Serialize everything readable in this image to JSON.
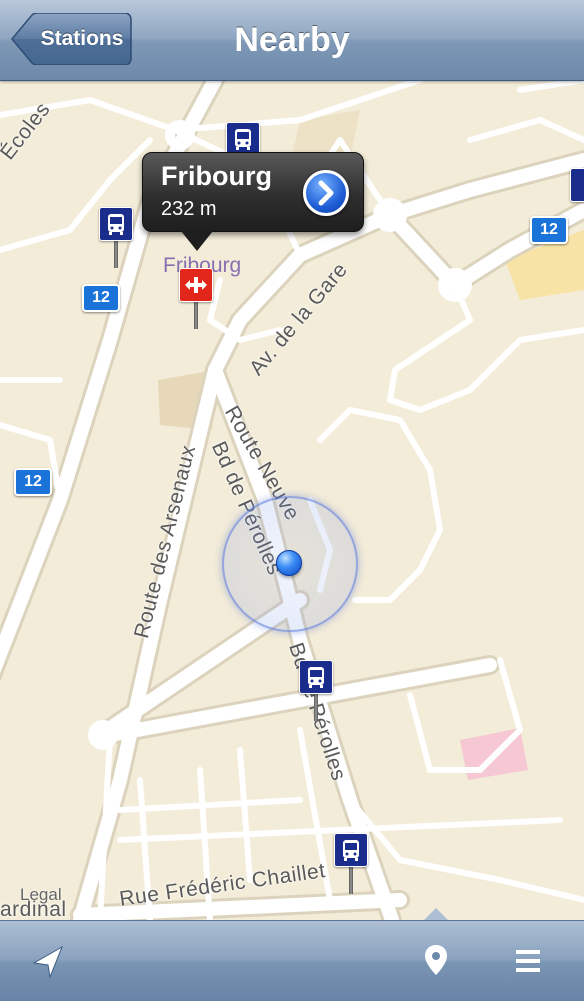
{
  "navbar": {
    "back_label": "Stations",
    "title": "Nearby"
  },
  "callout": {
    "title": "Fribourg",
    "distance": "232 m"
  },
  "map": {
    "place_label": "Fribourg",
    "route_number": "12",
    "streets": {
      "ecoles": "Écoles",
      "av_gare": "Av. de la Gare",
      "route_neuve": "Route Neuve",
      "bd_perolles": "Bd de Pérolles",
      "route_arsenaux": "Route des Arsenaux",
      "bd_perolles_2": "Bd de Pérolles",
      "rue_chaillet": "Rue Frédéric Chaillet",
      "cardinal": "ardinal"
    },
    "legal": "Legal"
  },
  "colors": {
    "bus_stop": "#1a2c8c",
    "train_station": "#e3261b",
    "route_badge": "#1a73d9",
    "user_location": "#1e7cf0"
  },
  "icons": {
    "back": "chevron-left-icon",
    "locate": "location-arrow-icon",
    "pin": "map-pin-icon",
    "list": "list-icon"
  }
}
